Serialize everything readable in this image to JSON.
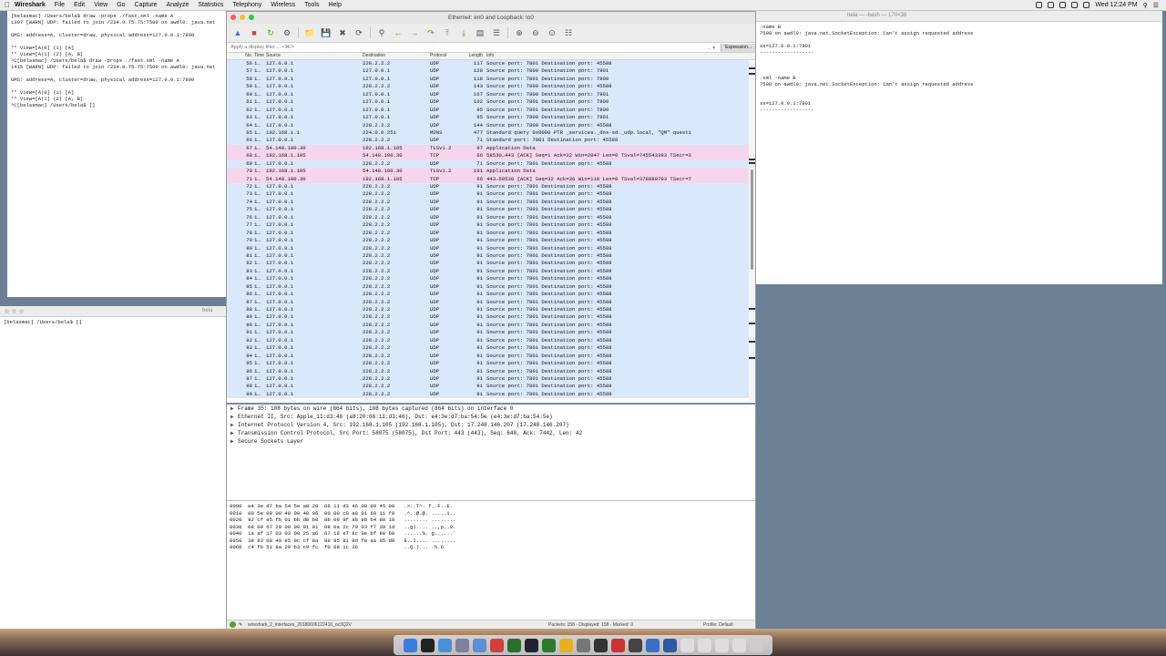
{
  "menubar": {
    "app": "Wireshark",
    "items": [
      "File",
      "Edit",
      "View",
      "Go",
      "Capture",
      "Analyze",
      "Statistics",
      "Telephony",
      "Wireless",
      "Tools",
      "Help"
    ],
    "clock": "Wed 12:24 PM"
  },
  "term_top_left": {
    "lines": [
      "[belasmac] /Users/bela$ draw -props ./fast.xml -name A",
      "1307 [WARN] UDP: failed to join /224.0.75.75:7500 on awdl0: java.net",
      "",
      "GMS: address=A, cluster=draw, physical address=127.0.0.1:7800",
      "",
      "** View=[A|0] (1) [A]",
      "** View=[A|1] (2) [A, B]",
      "^C[belasmac] /Users/bela$ draw -props ./fast.xml -name A",
      "1415 [WARN] UDP: failed to join /224.0.75.75:7500 on awdl0: java.net",
      "",
      "GMS: address=A, cluster=draw, physical address=127.0.0.1:7800",
      "",
      "** View=[A|0] (1) [A]",
      "** View=[A|1] (2) [A, B]",
      "^C[belasmac] /Users/bela$ []"
    ]
  },
  "term_bottom_left": {
    "title": "bela",
    "lines": [
      "[belasmac] /Users/bela$ []"
    ]
  },
  "term_right": {
    "title": "bela — -bash — 170×38",
    "lines": [
      "-name B",
      "7500 on awdl0: java.net.SocketException: Can't assign requested address",
      "",
      "ss=127.0.0.1:7801",
      "------------------",
      "",
      "",
      "",
      ".xml -name B",
      "7500 on awdl0: java.net.SocketException: Can't assign requested address",
      "",
      "",
      "ss=127.0.0.1:7801",
      "------------------"
    ]
  },
  "wireshark": {
    "title": "Ethernet: en0 and Loopback: lo0",
    "filter_placeholder": "Apply a display filter ... <⌘/>",
    "expression_label": "Expression...",
    "columns": {
      "no": "No.",
      "time": "Time",
      "source": "Source",
      "destination": "Destination",
      "protocol": "Protocol",
      "length": "Length",
      "info": "Info"
    },
    "packets": [
      {
        "no": "56",
        "t": "1…",
        "src": "127.0.0.1",
        "dst": "228.2.2.2",
        "proto": "UDP",
        "len": "117",
        "info": "Source port: 7801  Destination port: 45588"
      },
      {
        "no": "57",
        "t": "1…",
        "src": "127.0.0.1",
        "dst": "127.0.0.1",
        "proto": "UDP",
        "len": "128",
        "info": "Source port: 7800  Destination port: 7801"
      },
      {
        "no": "58",
        "t": "1…",
        "src": "127.0.0.1",
        "dst": "127.0.0.1",
        "proto": "UDP",
        "len": "118",
        "info": "Source port: 7801  Destination port: 7800"
      },
      {
        "no": "59",
        "t": "1…",
        "src": "127.0.0.1",
        "dst": "228.2.2.2",
        "proto": "UDP",
        "len": "143",
        "info": "Source port: 7800  Destination port: 45588"
      },
      {
        "no": "60",
        "t": "1…",
        "src": "127.0.0.1",
        "dst": "127.0.0.1",
        "proto": "UDP",
        "len": "167",
        "info": "Source port: 7800  Destination port: 7801"
      },
      {
        "no": "61",
        "t": "1…",
        "src": "127.0.0.1",
        "dst": "127.0.0.1",
        "proto": "UDP",
        "len": "102",
        "info": "Source port: 7801  Destination port: 7800"
      },
      {
        "no": "62",
        "t": "1…",
        "src": "127.0.0.1",
        "dst": "127.0.0.1",
        "proto": "UDP",
        "len": "95",
        "info": "Source port: 7801  Destination port: 7800"
      },
      {
        "no": "63",
        "t": "1…",
        "src": "127.0.0.1",
        "dst": "127.0.0.1",
        "proto": "UDP",
        "len": "95",
        "info": "Source port: 7800  Destination port: 7801"
      },
      {
        "no": "64",
        "t": "1…",
        "src": "127.0.0.1",
        "dst": "228.2.2.2",
        "proto": "UDP",
        "len": "144",
        "info": "Source port: 7800  Destination port: 45588"
      },
      {
        "no": "65",
        "t": "1…",
        "src": "192.168.1.1",
        "dst": "224.0.0.251",
        "proto": "MDNS",
        "len": "477",
        "info": "Standard query 0x0000 PTR _services._dns-sd._udp.local, \"QM\" questi"
      },
      {
        "no": "66",
        "t": "1…",
        "src": "127.0.0.1",
        "dst": "228.2.2.2",
        "proto": "UDP",
        "len": "71",
        "info": "Standard port: 7801  Destination port: 45588"
      },
      {
        "no": "67",
        "t": "1…",
        "src": "54.148.100.30",
        "dst": "192.168.1.105",
        "proto": "TLSv1.2",
        "len": "97",
        "info": "Application Data"
      },
      {
        "no": "68",
        "t": "1…",
        "src": "192.168.1.105",
        "dst": "54.148.100.30",
        "proto": "TCP",
        "len": "66",
        "info": "58530→443 [ACK] Seq=1 Ack=32 Win=2047 Len=0 TSval=745543393 TSecr=3"
      },
      {
        "no": "69",
        "t": "1…",
        "src": "127.0.0.1",
        "dst": "228.2.2.2",
        "proto": "UDP",
        "len": "71",
        "info": "Source port: 7801  Destination port: 45588"
      },
      {
        "no": "70",
        "t": "1…",
        "src": "192.168.1.105",
        "dst": "54.148.100.30",
        "proto": "TLSv1.2",
        "len": "101",
        "info": "Application Data"
      },
      {
        "no": "71",
        "t": "1…",
        "src": "54.148.100.30",
        "dst": "192.168.1.105",
        "proto": "TCP",
        "len": "66",
        "info": "443→58530 [ACK] Seq=32 Ack=36 Win=118 Len=0 TSval=378880703 TSecr=7"
      },
      {
        "no": "72",
        "t": "1…",
        "src": "127.0.0.1",
        "dst": "228.2.2.2",
        "proto": "UDP",
        "len": "91",
        "info": "Source port: 7801  Destination port: 45588"
      },
      {
        "no": "73",
        "t": "1…",
        "src": "127.0.0.1",
        "dst": "228.2.2.2",
        "proto": "UDP",
        "len": "91",
        "info": "Source port: 7801  Destination port: 45588"
      },
      {
        "no": "74",
        "t": "1…",
        "src": "127.0.0.1",
        "dst": "228.2.2.2",
        "proto": "UDP",
        "len": "91",
        "info": "Source port: 7801  Destination port: 45588"
      },
      {
        "no": "75",
        "t": "1…",
        "src": "127.0.0.1",
        "dst": "228.2.2.2",
        "proto": "UDP",
        "len": "91",
        "info": "Source port: 7801  Destination port: 45588"
      },
      {
        "no": "76",
        "t": "1…",
        "src": "127.0.0.1",
        "dst": "228.2.2.2",
        "proto": "UDP",
        "len": "91",
        "info": "Source port: 7801  Destination port: 45588"
      },
      {
        "no": "77",
        "t": "1…",
        "src": "127.0.0.1",
        "dst": "228.2.2.2",
        "proto": "UDP",
        "len": "91",
        "info": "Source port: 7801  Destination port: 45588"
      },
      {
        "no": "78",
        "t": "1…",
        "src": "127.0.0.1",
        "dst": "228.2.2.2",
        "proto": "UDP",
        "len": "91",
        "info": "Source port: 7801  Destination port: 45588"
      },
      {
        "no": "79",
        "t": "1…",
        "src": "127.0.0.1",
        "dst": "228.2.2.2",
        "proto": "UDP",
        "len": "91",
        "info": "Source port: 7801  Destination port: 45588"
      },
      {
        "no": "80",
        "t": "1…",
        "src": "127.0.0.1",
        "dst": "228.2.2.2",
        "proto": "UDP",
        "len": "91",
        "info": "Source port: 7801  Destination port: 45588"
      },
      {
        "no": "81",
        "t": "1…",
        "src": "127.0.0.1",
        "dst": "228.2.2.2",
        "proto": "UDP",
        "len": "91",
        "info": "Source port: 7801  Destination port: 45588"
      },
      {
        "no": "82",
        "t": "1…",
        "src": "127.0.0.1",
        "dst": "228.2.2.2",
        "proto": "UDP",
        "len": "91",
        "info": "Source port: 7801  Destination port: 45588"
      },
      {
        "no": "83",
        "t": "1…",
        "src": "127.0.0.1",
        "dst": "228.2.2.2",
        "proto": "UDP",
        "len": "91",
        "info": "Source port: 7801  Destination port: 45588"
      },
      {
        "no": "84",
        "t": "1…",
        "src": "127.0.0.1",
        "dst": "228.2.2.2",
        "proto": "UDP",
        "len": "91",
        "info": "Source port: 7801  Destination port: 45588"
      },
      {
        "no": "85",
        "t": "1…",
        "src": "127.0.0.1",
        "dst": "228.2.2.2",
        "proto": "UDP",
        "len": "91",
        "info": "Source port: 7801  Destination port: 45588"
      },
      {
        "no": "86",
        "t": "1…",
        "src": "127.0.0.1",
        "dst": "228.2.2.2",
        "proto": "UDP",
        "len": "91",
        "info": "Source port: 7801  Destination port: 45588"
      },
      {
        "no": "87",
        "t": "1…",
        "src": "127.0.0.1",
        "dst": "228.2.2.2",
        "proto": "UDP",
        "len": "91",
        "info": "Source port: 7801  Destination port: 45588"
      },
      {
        "no": "88",
        "t": "1…",
        "src": "127.0.0.1",
        "dst": "228.2.2.2",
        "proto": "UDP",
        "len": "91",
        "info": "Source port: 7801  Destination port: 45588"
      },
      {
        "no": "89",
        "t": "1…",
        "src": "127.0.0.1",
        "dst": "228.2.2.2",
        "proto": "UDP",
        "len": "91",
        "info": "Source port: 7801  Destination port: 45588"
      },
      {
        "no": "90",
        "t": "1…",
        "src": "127.0.0.1",
        "dst": "228.2.2.2",
        "proto": "UDP",
        "len": "91",
        "info": "Source port: 7801  Destination port: 45588"
      },
      {
        "no": "91",
        "t": "1…",
        "src": "127.0.0.1",
        "dst": "228.2.2.2",
        "proto": "UDP",
        "len": "91",
        "info": "Source port: 7801  Destination port: 45588"
      },
      {
        "no": "92",
        "t": "1…",
        "src": "127.0.0.1",
        "dst": "228.2.2.2",
        "proto": "UDP",
        "len": "91",
        "info": "Source port: 7801  Destination port: 45588"
      },
      {
        "no": "93",
        "t": "1…",
        "src": "127.0.0.1",
        "dst": "228.2.2.2",
        "proto": "UDP",
        "len": "91",
        "info": "Source port: 7801  Destination port: 45588"
      },
      {
        "no": "94",
        "t": "1…",
        "src": "127.0.0.1",
        "dst": "228.2.2.2",
        "proto": "UDP",
        "len": "91",
        "info": "Source port: 7801  Destination port: 45588"
      },
      {
        "no": "95",
        "t": "1…",
        "src": "127.0.0.1",
        "dst": "228.2.2.2",
        "proto": "UDP",
        "len": "91",
        "info": "Source port: 7801  Destination port: 45588"
      },
      {
        "no": "96",
        "t": "1…",
        "src": "127.0.0.1",
        "dst": "228.2.2.2",
        "proto": "UDP",
        "len": "91",
        "info": "Source port: 7801  Destination port: 45588"
      },
      {
        "no": "97",
        "t": "1…",
        "src": "127.0.0.1",
        "dst": "228.2.2.2",
        "proto": "UDP",
        "len": "91",
        "info": "Source port: 7801  Destination port: 45588"
      },
      {
        "no": "98",
        "t": "1…",
        "src": "127.0.0.1",
        "dst": "228.2.2.2",
        "proto": "UDP",
        "len": "91",
        "info": "Source port: 7801  Destination port: 45588"
      },
      {
        "no": "99",
        "t": "1…",
        "src": "127.0.0.1",
        "dst": "228.2.2.2",
        "proto": "UDP",
        "len": "91",
        "info": "Source port: 7801  Destination port: 45588"
      }
    ],
    "details": [
      "Frame 35: 108 bytes on wire (864 bits), 108 bytes captured (864 bits) on interface 0",
      "Ethernet II, Src: Apple_11:d3:46 (a8:20:66:11:d3:46), Dst: e4:3e:d7:ba:54:5e (e4:3e:d7:ba:54:5e)",
      "Internet Protocol Version 4, Src: 192.168.1.105 (192.168.1.105), Dst: 17.248.146.207 (17.248.146.207)",
      "Transmission Control Protocol, Src Port: 58075 (58075), Dst Port: 443 (443), Seq: 648, Ack: 7442, Len: 42",
      "Secure Sockets Layer"
    ],
    "hex": [
      "0000  e4 3e d7 ba 54 5e a8 20  66 11 d3 46 08 00 45 00   .>..T^. f..F..E.",
      "0010  00 5e 00 00 40 00 40 06  00 00 c0 a8 01 69 11 f8   .^..@.@. .....i..",
      "0020  92 cf e5 fb 01 bb d8 b0  8b 09 9f ab eb b4 80 18   ........ ........",
      "0030  08 00 67 29 00 00 01 01  08 0a 2c 70 03 f7 39 1d   ..g).... ..,p..9.",
      "0040  1a af 17 03 03 00 25 a6  67 19 e7 8c 9e bf 80 60   ......%. g......`",
      "0050  38 83 09 49 e5 0c cf 8a  09 85 81 8d f8 aa 05 d0   8..I.... ........",
      "0060  c4 f6 51 8a 29 b3 c9 fc  f0 68 1c 36               ..Q.)... .h.6"
    ],
    "status_file": "wireshark_2_interfaces_20180606122416_oz3Q2V",
    "status_counts": "Packets: 158 · Displayed: 158 · Marked: 0",
    "status_profile": "Profile: Default"
  },
  "colors": {
    "udp": "#dae8fc",
    "tcp": "#f5d6ec",
    "accent": "#6f8db8"
  }
}
